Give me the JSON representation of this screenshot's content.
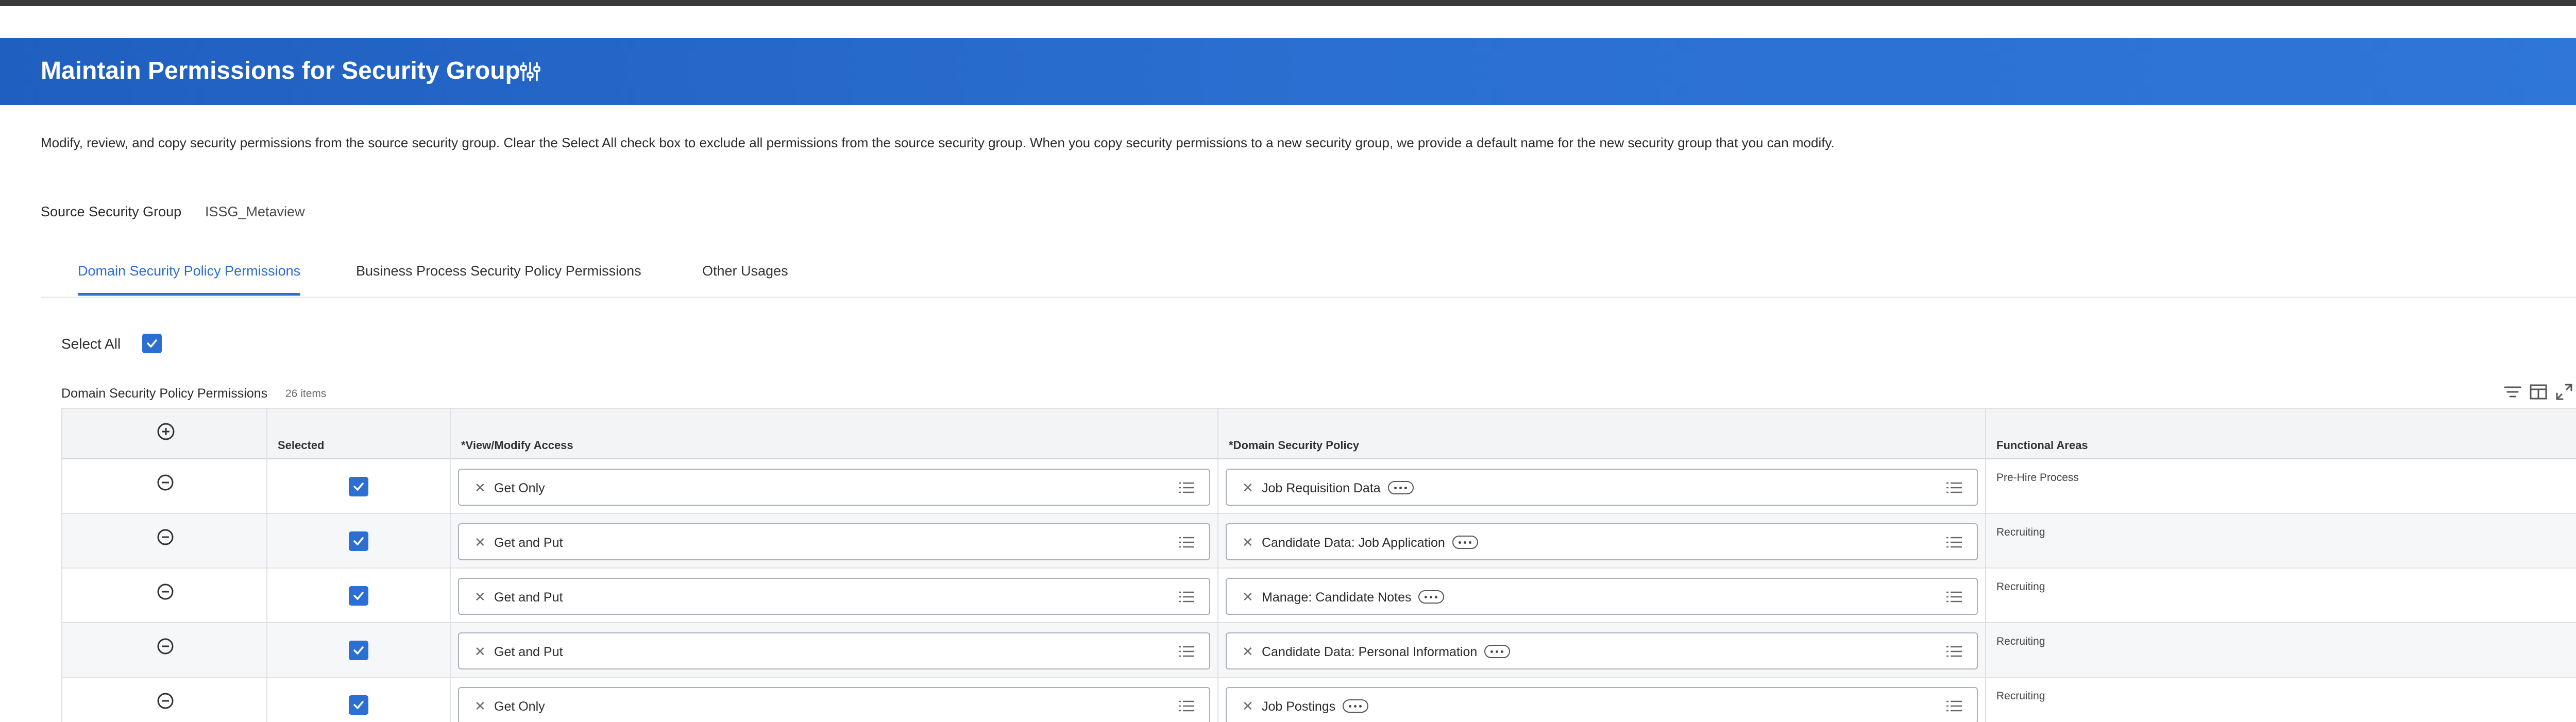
{
  "header": {
    "title": "Maintain Permissions for Security Group"
  },
  "description": "Modify, review, and copy security permissions from the source security group. Clear the Select All check box to exclude all permissions from the source security group. When you copy security permissions to a new security group, we provide a default name for the new security group that you can modify.",
  "source": {
    "label": "Source Security Group",
    "value": "ISSG_Metaview"
  },
  "tabs": [
    {
      "label": "Domain Security Policy Permissions",
      "active": true
    },
    {
      "label": "Business Process Security Policy Permissions",
      "active": false
    },
    {
      "label": "Other Usages",
      "active": false
    }
  ],
  "select_all": {
    "label": "Select All",
    "checked": true
  },
  "grid": {
    "title": "Domain Security Policy Permissions",
    "count": "26 items",
    "columns": [
      "Selected",
      "*View/Modify Access",
      "*Domain Security Policy",
      "Functional Areas"
    ],
    "rows": [
      {
        "selected": true,
        "access": "Get Only",
        "policy": "Job Requisition Data",
        "area": "Pre-Hire Process"
      },
      {
        "selected": true,
        "access": "Get and Put",
        "policy": "Candidate Data: Job Application",
        "area": "Recruiting"
      },
      {
        "selected": true,
        "access": "Get and Put",
        "policy": "Manage: Candidate Notes",
        "area": "Recruiting"
      },
      {
        "selected": true,
        "access": "Get and Put",
        "policy": "Candidate Data: Personal Information",
        "area": "Recruiting"
      },
      {
        "selected": true,
        "access": "Get Only",
        "policy": "Job Postings",
        "area": "Recruiting"
      }
    ]
  },
  "icons": {
    "close": "close-icon",
    "settings": "sliders-icon",
    "bookmark": "bookmark-icon",
    "add_row": "plus-circle-icon",
    "remove_row": "minus-circle-icon",
    "clear": "x-icon",
    "prompt": "list-icon",
    "related_actions": "more-icon",
    "filter": "filter-icon",
    "columns": "columns-icon",
    "fullscreen": "expand-icon"
  },
  "colors": {
    "accent": "#2a6fd1",
    "header": "#1f5fbf"
  }
}
